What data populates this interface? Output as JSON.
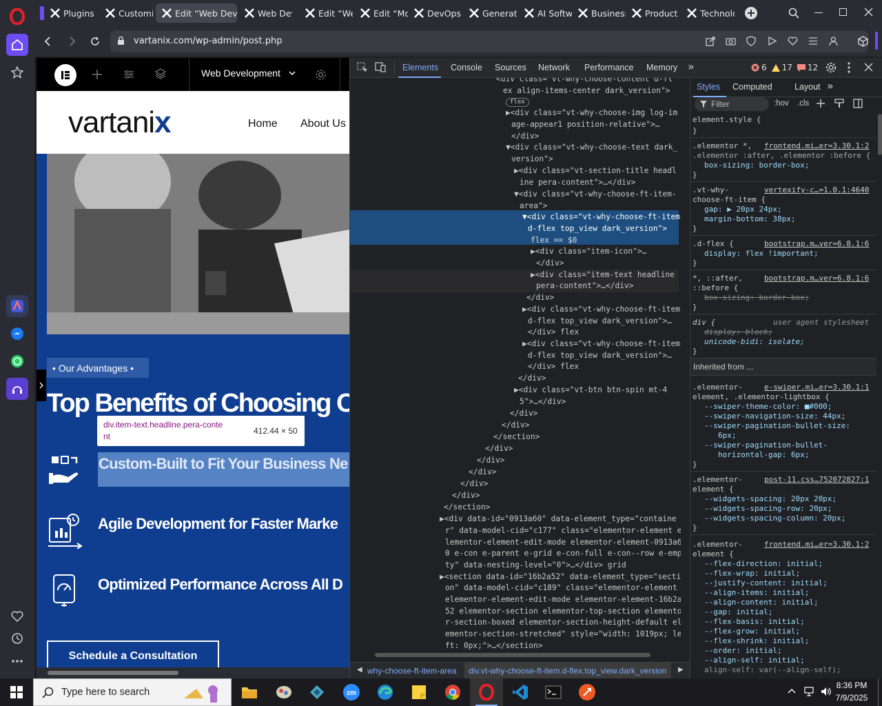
{
  "browser": {
    "tabs": [
      {
        "label": "Plugins ‹"
      },
      {
        "label": "Customiz"
      },
      {
        "label": "Edit “Web Devel"
      },
      {
        "label": "Web Dev"
      },
      {
        "label": "Edit “Web"
      },
      {
        "label": "Edit “Mob"
      },
      {
        "label": "DevOps C"
      },
      {
        "label": "Generativ"
      },
      {
        "label": "AI Softwa"
      },
      {
        "label": "Business"
      },
      {
        "label": "Product S"
      },
      {
        "label": "Technolog"
      }
    ],
    "url": "vartanix.com/wp-admin/post.php"
  },
  "editor": {
    "page_title": "Web Development",
    "logo_text": "vartani",
    "nav": [
      "Home",
      "About Us"
    ],
    "badge": "• Our Advantages •",
    "heading": "Top Benefits of Choosing Ou",
    "tooltip_selector": "div.item-text.headline.pera-conte",
    "tooltip_selector2": "nt",
    "tooltip_size": "412.44 × 50",
    "benefits": [
      "Custom-Built to Fit Your Business Ne",
      "Agile Development for Faster Marke",
      "Optimized Performance Across All D"
    ],
    "cta": "Schedule a Consultation"
  },
  "devtools": {
    "tabs": [
      "Elements",
      "Console",
      "Sources",
      "Network",
      "Performance",
      "Memory"
    ],
    "errors": "6",
    "warnings": "17",
    "issues": "12",
    "dom_lines": [
      {
        "t": "<div class=\"vt-why-choose-content d-fl",
        "i": 0
      },
      {
        "t": "ex align-items-center dark_version\">",
        "i": 0
      },
      {
        "t": "flex",
        "i": 0
      },
      {
        "t": "▶<div class=\"vt-why-choose-img log-im",
        "i": 0
      },
      {
        "t": "age-appear1 position-relative\">…",
        "i": 0
      },
      {
        "t": "</div>",
        "i": 0
      },
      {
        "t": "▼<div class=\"vt-why-choose-text dark_",
        "i": 0
      },
      {
        "t": "version\">",
        "i": 0
      },
      {
        "t": "▶<div class=\"vt-section-title headl",
        "i": 0
      },
      {
        "t": "ine pera-content\">…</div>",
        "i": 0
      },
      {
        "t": "▼<div class=\"vt-why-choose-ft-item-",
        "i": 0
      },
      {
        "t": "area\">",
        "i": 0
      },
      {
        "t": "▼<div class=\"vt-why-choose-ft-item",
        "i": 0
      },
      {
        "t": "d-flex top_view dark_version\">",
        "i": 0
      },
      {
        "t": "flex == $0",
        "i": 0
      },
      {
        "t": "▶<div class=\"item-icon\">…",
        "i": 0
      },
      {
        "t": "</div>",
        "i": 0
      },
      {
        "t": "▶<div class=\"item-text headline",
        "i": 0
      },
      {
        "t": "pera-content\">…</div>",
        "i": 0
      },
      {
        "t": "</div>",
        "i": 0
      },
      {
        "t": "▶<div class=\"vt-why-choose-ft-item",
        "i": 0
      },
      {
        "t": "d-flex top_view dark_version\">…",
        "i": 0
      },
      {
        "t": "</div> flex",
        "i": 0
      },
      {
        "t": "▶<div class=\"vt-why-choose-ft-item",
        "i": 0
      },
      {
        "t": "d-flex top_view dark_version\">…",
        "i": 0
      },
      {
        "t": "</div> flex",
        "i": 0
      },
      {
        "t": "</div>",
        "i": 0
      },
      {
        "t": "▶<div class=\"vt-btn btn-spin mt-4",
        "i": 0
      },
      {
        "t": "5\">…</div>",
        "i": 0
      },
      {
        "t": "</div>",
        "i": 0
      },
      {
        "t": "</div>",
        "i": 0
      },
      {
        "t": "</section>",
        "i": 0
      },
      {
        "t": "</div>",
        "i": 0
      },
      {
        "t": "</div>",
        "i": 0
      },
      {
        "t": "</div>",
        "i": 0
      },
      {
        "t": "</div>",
        "i": 0
      },
      {
        "t": "</div>",
        "i": 0
      },
      {
        "t": "</section>",
        "i": 0
      },
      {
        "t": "▶<div data-id=\"0913a60\" data-element_type=\"containe",
        "i": 0
      },
      {
        "t": "r\" data-model-cid=\"c177\" class=\"elementor-element e",
        "i": 0
      },
      {
        "t": "lementor-element-edit-mode elementor-element-0913a6",
        "i": 0
      },
      {
        "t": "0 e-con e-parent e-grid e-con-full e-con--row e-emp",
        "i": 0
      },
      {
        "t": "ty\" data-nesting-level=\"0\">…</div> grid",
        "i": 0
      },
      {
        "t": "▶<section data-id=\"16b2a52\" data-element_type=\"secti",
        "i": 0
      },
      {
        "t": "on\" data-model-cid=\"c189\" class=\"elementor-element",
        "i": 0
      },
      {
        "t": "elementor-element-edit-mode elementor-element-16b2a",
        "i": 0
      },
      {
        "t": "52 elementor-section elementor-top-section elemento",
        "i": 0
      },
      {
        "t": "r-section-boxed elementor-section-height-default el",
        "i": 0
      },
      {
        "t": "ementor-section-stretched\" style=\"width: 1019px; le",
        "i": 0
      },
      {
        "t": "ft: 0px;\">…</section>",
        "i": 0
      }
    ],
    "breadcrumbs": [
      "why-choose-ft-item-area",
      "div.vt-why-choose-ft-item.d-flex.top_view.dark_version"
    ],
    "styles_tabs": [
      "Styles",
      "Computed",
      "Layout"
    ],
    "filter_placeholder": "Filter",
    "hov": ":hov",
    "cls": ".cls",
    "inherited_label": "Inherited from ...",
    "style_lines": [
      "element.style {",
      "}",
      ".elementor *,",
      "frontend.mi…er=3.30.1:2",
      ".elementor :after, .elementor :before {",
      "box-sizing: border-box;",
      "}",
      ".vt-why-",
      "vertexify-c…=1.0.1:4640",
      "choose-ft-item {",
      "gap: ▶ 20px 24px;",
      "margin-bottom: 38px;",
      "}",
      ".d-flex {",
      "bootstrap.m…ver=6.8.1:6",
      "display: flex !important;",
      "}",
      "*, ::after,",
      "bootstrap.m…ver=6.8.1:6",
      "::before {",
      "box-sizing: border-box;",
      "}",
      "div {",
      "user agent stylesheet",
      "display: block;",
      "unicode-bidi: isolate;",
      "}",
      ".elementor-",
      "e-swiper.mi…er=3.30.1:1",
      "element, .elementor-lightbox {",
      "--swiper-theme-color: ■#000;",
      "--swiper-navigation-size: 44px;",
      "--swiper-pagination-bullet-size:",
      "6px;",
      "--swiper-pagination-bullet-",
      "horizontal-gap: 6px;",
      "}",
      ".elementor-",
      "post-11.css…752072827:1",
      "element {",
      "--widgets-spacing: 20px 20px;",
      "--widgets-spacing-row: 20px;",
      "--widgets-spacing-column: 20px;",
      "}",
      ".elementor-",
      "frontend.mi…er=3.30.1:2",
      "element {",
      "--flex-direction: initial;",
      "--flex-wrap: initial;",
      "--justify-content: initial;",
      "--align-items: initial;",
      "--align-content: initial;",
      "--gap: initial;",
      "--flex-basis: initial;",
      "--flex-grow: initial;",
      "--flex-shrink: initial;",
      "--order: initial;",
      "--align-self: initial;",
      "align-self: var(--align-self);"
    ]
  },
  "taskbar": {
    "search_placeholder": "Type here to search",
    "time": "8:36 PM",
    "date": "7/9/2025"
  },
  "colors": {
    "page_blue": "#0f3d8f",
    "selected_row": "#1d4e7f",
    "opera_red": "#e8202a",
    "active_tab": "#45464f"
  }
}
